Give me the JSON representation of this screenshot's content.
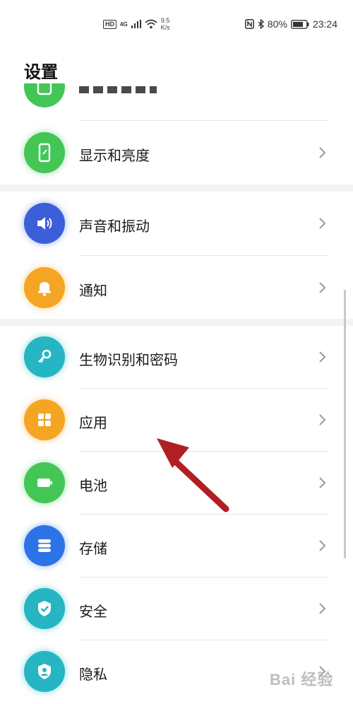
{
  "status_bar": {
    "network_badge": "HD",
    "network_type": "4G",
    "speed_value": "9.5",
    "speed_unit": "K/s",
    "battery_percent": "80%",
    "time": "23:24"
  },
  "header": {
    "title": "设置"
  },
  "settings": {
    "display": "显示和亮度",
    "sound": "声音和振动",
    "notifications": "通知",
    "biometrics": "生物识别和密码",
    "apps": "应用",
    "battery": "电池",
    "storage": "存储",
    "security": "安全",
    "privacy": "隐私"
  },
  "icons": {
    "partial_top": "tablet-icon",
    "display": "phone-display-icon",
    "sound": "speaker-icon",
    "notifications": "bell-icon",
    "biometrics": "key-icon",
    "apps": "apps-grid-icon",
    "battery": "battery-icon",
    "storage": "storage-icon",
    "security": "shield-check-icon",
    "privacy": "privacy-shield-icon"
  },
  "colors": {
    "green": "#43c656",
    "blue": "#3b5fd9",
    "orange": "#f5a524",
    "teal": "#26b5c3",
    "storage_blue": "#2c73e6",
    "arrow": "#b01f24"
  },
  "watermark": "Bai 经验"
}
